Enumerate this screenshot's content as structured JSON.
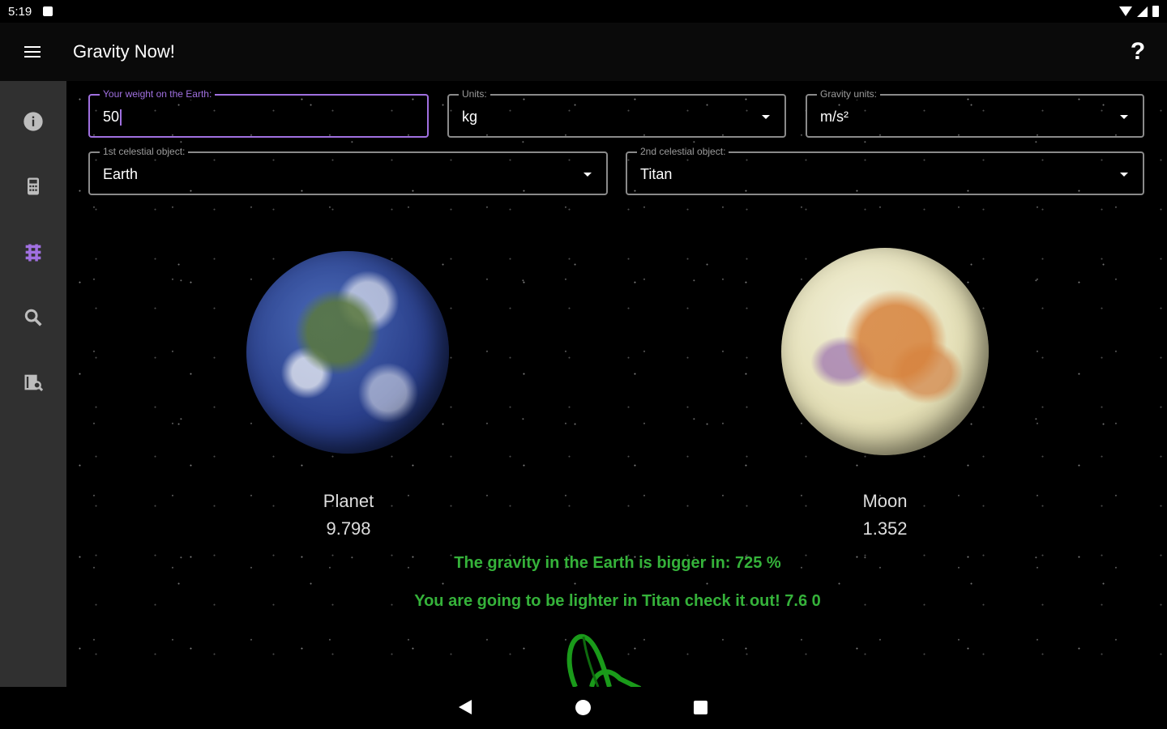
{
  "status_bar": {
    "time": "5:19"
  },
  "app_bar": {
    "title": "Gravity Now!",
    "help_label": "?"
  },
  "nav_rail": {
    "items": [
      {
        "icon": "info-icon"
      },
      {
        "icon": "calculator-icon"
      },
      {
        "icon": "compare-icon",
        "active": true
      },
      {
        "icon": "search-icon"
      },
      {
        "icon": "map-search-icon"
      }
    ]
  },
  "form": {
    "weight": {
      "label": "Your weight on the Earth:",
      "value": "50"
    },
    "units": {
      "label": "Units:",
      "value": "kg"
    },
    "gravity_units": {
      "label": "Gravity units:",
      "value": "m/s²"
    },
    "first_object": {
      "label": "1st celestial object:",
      "value": "Earth"
    },
    "second_object": {
      "label": "2nd celestial object:",
      "value": "Titan"
    }
  },
  "bodies": {
    "first": {
      "type": "Planet",
      "gravity": "9.798"
    },
    "second": {
      "type": "Moon",
      "gravity": "1.352"
    }
  },
  "results": {
    "comparison": "The gravity in the Earth is bigger in: 725 %",
    "lighter": "You are going to be lighter in Titan check it out! 7.6 0"
  },
  "colors": {
    "accent": "#a070e0",
    "result_text": "#35b23a",
    "rail_bg": "#303030"
  }
}
